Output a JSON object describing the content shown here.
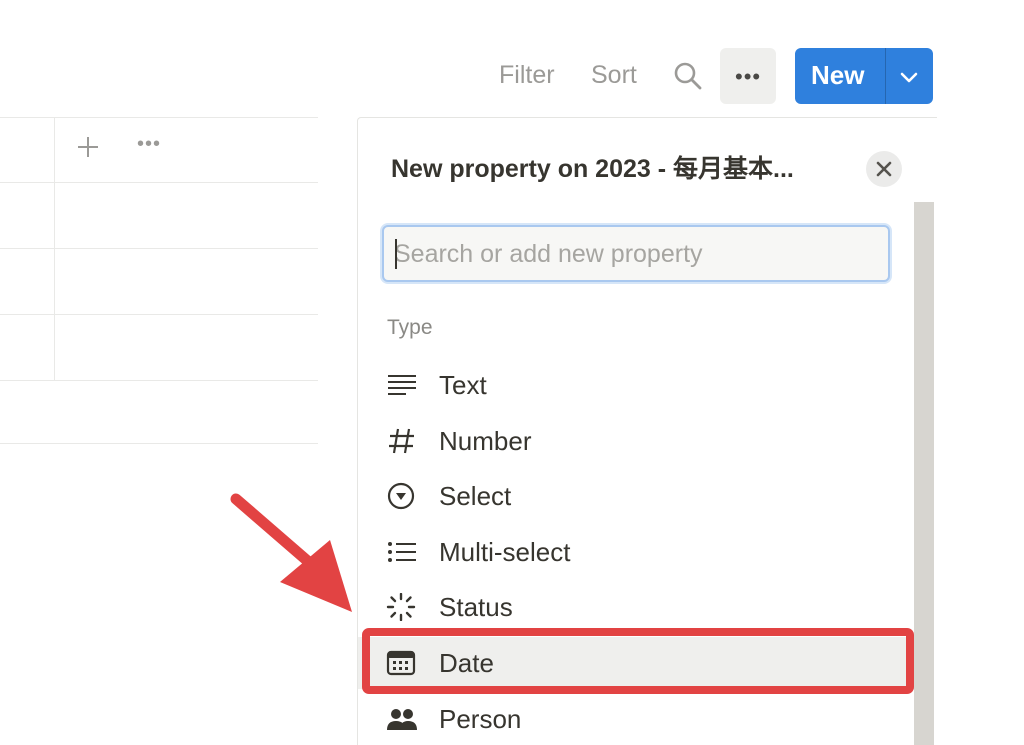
{
  "toolbar": {
    "filter_label": "Filter",
    "sort_label": "Sort",
    "search_icon": "search-icon",
    "more_label": "•••",
    "new_label": "New",
    "new_dropdown_icon": "chevron-down-icon",
    "new_color": "#2f80dd"
  },
  "table": {
    "add_column_icon": "plus-icon",
    "more_label": "•••"
  },
  "panel": {
    "title": "New property on 2023 - 每月基本...",
    "close_icon": "close-icon",
    "search": {
      "value": "",
      "placeholder": "Search or add new property"
    },
    "section_label": "Type",
    "items": [
      {
        "label": "Text",
        "icon": "text-lines-icon"
      },
      {
        "label": "Number",
        "icon": "hash-icon"
      },
      {
        "label": "Select",
        "icon": "select-circle-icon"
      },
      {
        "label": "Multi-select",
        "icon": "list-icon"
      },
      {
        "label": "Status",
        "icon": "status-loader-icon"
      },
      {
        "label": "Date",
        "icon": "calendar-icon"
      },
      {
        "label": "Person",
        "icon": "people-icon"
      }
    ],
    "selected_item": "Date"
  },
  "annotation": {
    "color": "#e24343"
  }
}
